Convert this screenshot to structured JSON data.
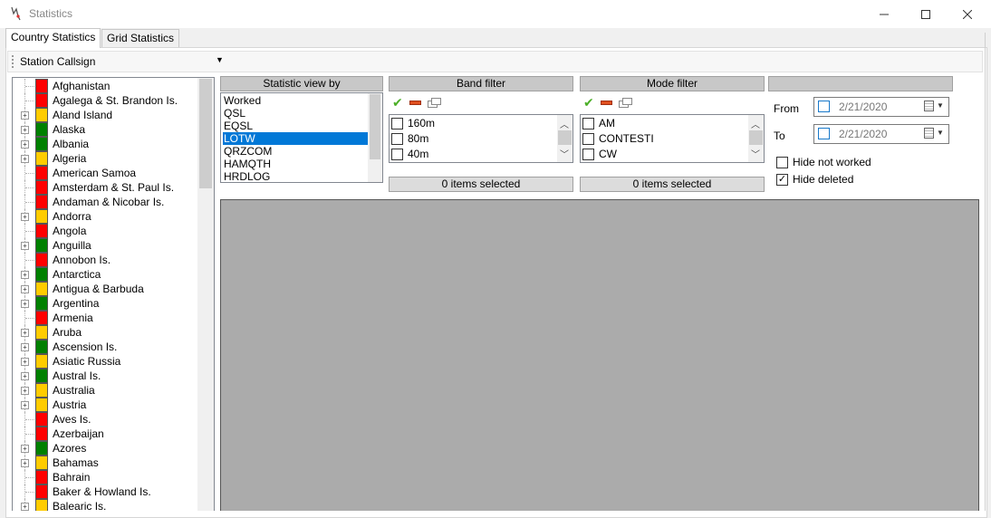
{
  "window": {
    "title": "Statistics"
  },
  "tabs": [
    {
      "label": "Country Statistics"
    },
    {
      "label": "Grid Statistics"
    }
  ],
  "station": {
    "label": "Station Callsign"
  },
  "countries": [
    {
      "name": "Afghanistan",
      "color": "#ff0000",
      "expandable": false
    },
    {
      "name": "Agalega & St. Brandon Is.",
      "color": "#ff0000",
      "expandable": false
    },
    {
      "name": "Aland Island",
      "color": "#ffcc00",
      "expandable": true
    },
    {
      "name": "Alaska",
      "color": "#008000",
      "expandable": true
    },
    {
      "name": "Albania",
      "color": "#008000",
      "expandable": true
    },
    {
      "name": "Algeria",
      "color": "#ffcc00",
      "expandable": true
    },
    {
      "name": "American Samoa",
      "color": "#ff0000",
      "expandable": false
    },
    {
      "name": "Amsterdam & St. Paul Is.",
      "color": "#ff0000",
      "expandable": false
    },
    {
      "name": "Andaman & Nicobar Is.",
      "color": "#ff0000",
      "expandable": false
    },
    {
      "name": "Andorra",
      "color": "#ffcc00",
      "expandable": true
    },
    {
      "name": "Angola",
      "color": "#ff0000",
      "expandable": false
    },
    {
      "name": "Anguilla",
      "color": "#008000",
      "expandable": true
    },
    {
      "name": "Annobon Is.",
      "color": "#ff0000",
      "expandable": false
    },
    {
      "name": "Antarctica",
      "color": "#008000",
      "expandable": true
    },
    {
      "name": "Antigua & Barbuda",
      "color": "#ffcc00",
      "expandable": true
    },
    {
      "name": "Argentina",
      "color": "#008000",
      "expandable": true
    },
    {
      "name": "Armenia",
      "color": "#ff0000",
      "expandable": false
    },
    {
      "name": "Aruba",
      "color": "#ffcc00",
      "expandable": true
    },
    {
      "name": "Ascension Is.",
      "color": "#008000",
      "expandable": true
    },
    {
      "name": "Asiatic Russia",
      "color": "#ffcc00",
      "expandable": true
    },
    {
      "name": "Austral Is.",
      "color": "#008000",
      "expandable": true
    },
    {
      "name": "Australia",
      "color": "#ffcc00",
      "expandable": true
    },
    {
      "name": "Austria",
      "color": "#ffcc00",
      "expandable": true
    },
    {
      "name": "Aves Is.",
      "color": "#ff0000",
      "expandable": false
    },
    {
      "name": "Azerbaijan",
      "color": "#ff0000",
      "expandable": false
    },
    {
      "name": "Azores",
      "color": "#008000",
      "expandable": true
    },
    {
      "name": "Bahamas",
      "color": "#ffcc00",
      "expandable": true
    },
    {
      "name": "Bahrain",
      "color": "#ff0000",
      "expandable": false
    },
    {
      "name": "Baker & Howland Is.",
      "color": "#ff0000",
      "expandable": false
    },
    {
      "name": "Balearic Is.",
      "color": "#ffcc00",
      "expandable": true
    }
  ],
  "stat_view": {
    "header": "Statistic view by",
    "items": [
      "Worked",
      "QSL",
      "EQSL",
      "LOTW",
      "QRZCOM",
      "HAMQTH",
      "HRDLOG"
    ],
    "selected": "LOTW"
  },
  "band_filter": {
    "header": "Band filter",
    "items": [
      "160m",
      "80m",
      "40m"
    ],
    "status": "0 items selected"
  },
  "mode_filter": {
    "header": "Mode filter",
    "items": [
      "AM",
      "CONTESTI",
      "CW"
    ],
    "status": "0 items selected"
  },
  "dates": {
    "header": "",
    "from_label": "From",
    "from_value": "2/21/2020",
    "to_label": "To",
    "to_value": "2/21/2020"
  },
  "options": {
    "hide_not_worked": {
      "label": "Hide not worked",
      "checked": false
    },
    "hide_deleted": {
      "label": "Hide deleted",
      "checked": true
    }
  },
  "icons": {
    "select_all": "check-icon",
    "deselect_all": "minus-icon",
    "windows": "windows-icon"
  }
}
